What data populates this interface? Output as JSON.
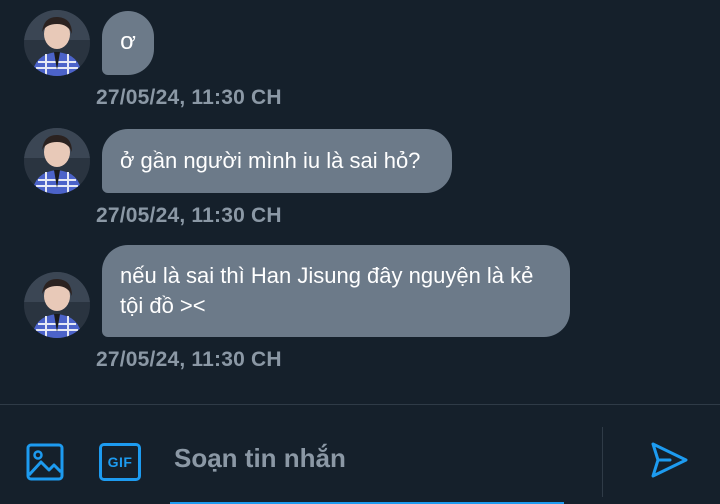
{
  "conversation": {
    "messages": [
      {
        "text": "ơ",
        "timestamp": "27/05/24, 11:30 CH"
      },
      {
        "text": "ở gần người mình iu là sai hỏ?",
        "timestamp": "27/05/24, 11:30 CH"
      },
      {
        "text": "nếu là sai thì Han Jisung đây nguyện là kẻ tội đồ ><",
        "timestamp": "27/05/24, 11:30 CH"
      }
    ]
  },
  "composer": {
    "placeholder": "Soạn tin nhắn",
    "media_icon": "image-icon",
    "gif_icon": "gif-icon",
    "gif_label": "GIF",
    "send_icon": "send-icon"
  },
  "colors": {
    "background": "#15202b",
    "bubble": "#6c7a89",
    "timestamp": "#8b98a5",
    "accent": "#1d9bf0"
  }
}
